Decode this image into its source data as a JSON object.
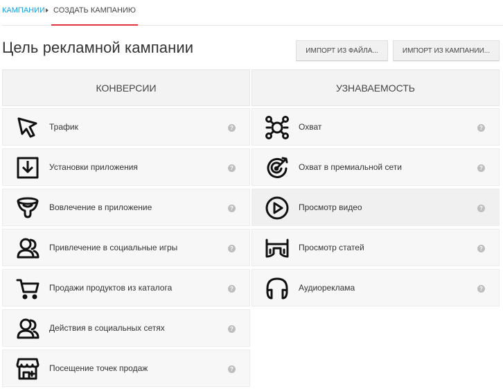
{
  "breadcrumb": {
    "link": "КАМПАНИИ",
    "current": "СОЗДАТЬ КАМПАНИЮ"
  },
  "page_title": "Цель рекламной кампании",
  "buttons": {
    "import_file": "ИМПОРТ ИЗ ФАЙЛА...",
    "import_campaign": "ИМПОРТ ИЗ КАМПАНИИ..."
  },
  "columns": {
    "left_title": "КОНВЕРСИИ",
    "right_title": "УЗНАВАЕМОСТЬ"
  },
  "left_items": [
    {
      "label": "Трафик",
      "icon": "cursor-icon"
    },
    {
      "label": "Установки приложения",
      "icon": "download-box-icon"
    },
    {
      "label": "Вовлечение в приложение",
      "icon": "funnel-icon"
    },
    {
      "label": "Привлечение в социальные игры",
      "icon": "users-icon"
    },
    {
      "label": "Продажи продуктов из каталога",
      "icon": "cart-icon"
    },
    {
      "label": "Действия в социальных сетях",
      "icon": "users-icon"
    },
    {
      "label": "Посещение точек продаж",
      "icon": "store-icon"
    }
  ],
  "right_items": [
    {
      "label": "Охват",
      "icon": "network-icon"
    },
    {
      "label": "Охват в премиальной сети",
      "icon": "target-icon"
    },
    {
      "label": "Просмотр видео",
      "icon": "play-icon"
    },
    {
      "label": "Просмотр статей",
      "icon": "glasses-icon"
    },
    {
      "label": "Аудиореклама",
      "icon": "headphones-icon"
    }
  ],
  "help_glyph": "?",
  "colors": {
    "accent_link": "#1aa0dd",
    "accent_underline": "#e0333e"
  }
}
